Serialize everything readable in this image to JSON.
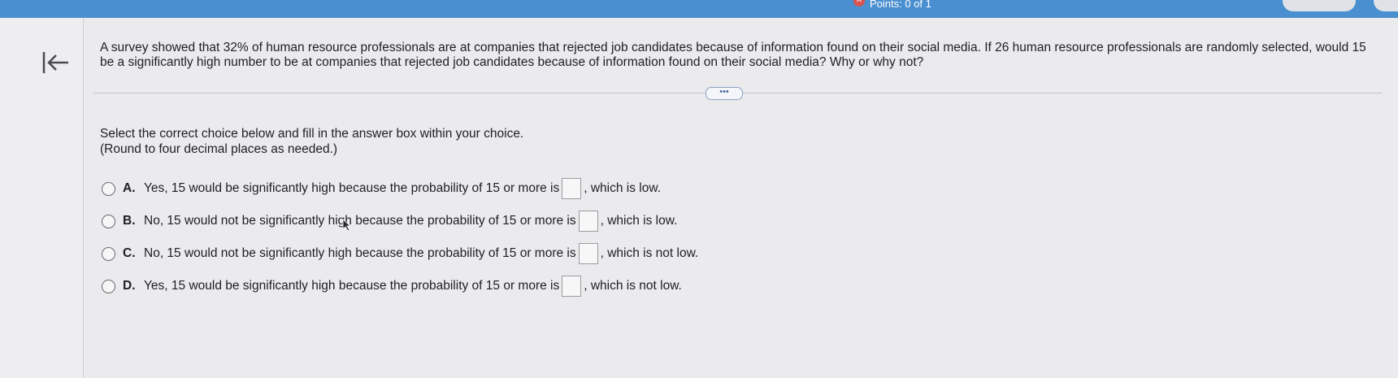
{
  "header": {
    "points_text": "Points: 0 of 1",
    "wrong_icon": "x-icon"
  },
  "nav": {
    "back_icon": "back-arrow-icon"
  },
  "question": {
    "text": "A survey showed that 32% of human resource professionals are at companies that rejected job candidates because of information found on their social media. If 26 human resource professionals are randomly selected, would 15 be a significantly high number to be at companies that rejected job candidates because of information found on their social media? Why or why not?"
  },
  "more_button": {
    "label": "•••"
  },
  "instructions": {
    "line1": "Select the correct choice below and fill in the answer box within your choice.",
    "line2": "(Round to four decimal places as needed.)"
  },
  "options": [
    {
      "letter": "A.",
      "before": "Yes, 15 would be significantly high because the probability of 15 or more is",
      "value": "",
      "after": ", which is low."
    },
    {
      "letter": "B.",
      "before": "No, 15 would not be significantly high because the probability of 15 or more is",
      "value": "",
      "after": ", which is low."
    },
    {
      "letter": "C.",
      "before": "No, 15 would not be significantly high because the probability of 15 or more is",
      "value": "",
      "after": ", which is not low."
    },
    {
      "letter": "D.",
      "before": "Yes, 15 would be significantly high because the probability of 15 or more is",
      "value": "",
      "after": ", which is not low."
    }
  ],
  "colors": {
    "topbar": "#4a8fcf",
    "background": "#ebeaec",
    "text": "#1f1f24"
  }
}
